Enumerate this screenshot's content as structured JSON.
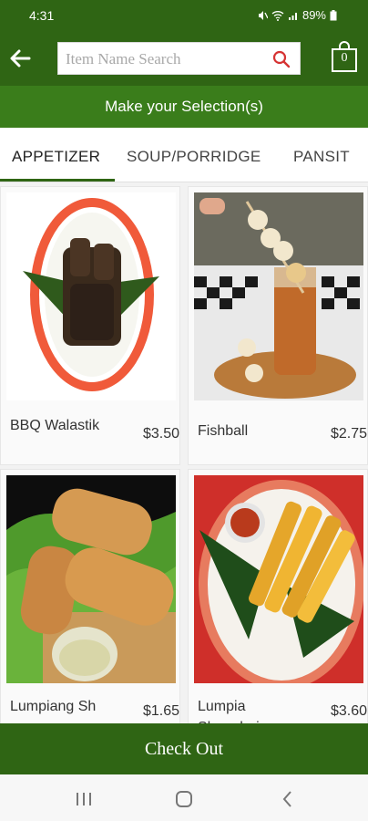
{
  "status": {
    "time": "4:31",
    "battery": "89%"
  },
  "search": {
    "placeholder": "Item Name Search"
  },
  "cart": {
    "count": "0"
  },
  "banner": {
    "text": "Make your Selection(s)"
  },
  "tabs": [
    {
      "label": "APPETIZER",
      "active": true
    },
    {
      "label": "SOUP/PORRIDGE"
    },
    {
      "label": "PANSIT"
    }
  ],
  "items": [
    {
      "name": "BBQ Walastik",
      "price": "$3.50"
    },
    {
      "name": "Fishball",
      "price": "$2.75"
    },
    {
      "name": "Lumpiang Sh",
      "price": "$1.65"
    },
    {
      "name": "Lumpia Shanghai",
      "price": "$3.60"
    }
  ],
  "checkout": {
    "label": "Check Out"
  },
  "colors": {
    "brand": "#2f6514",
    "banner": "#3a7d1b"
  }
}
